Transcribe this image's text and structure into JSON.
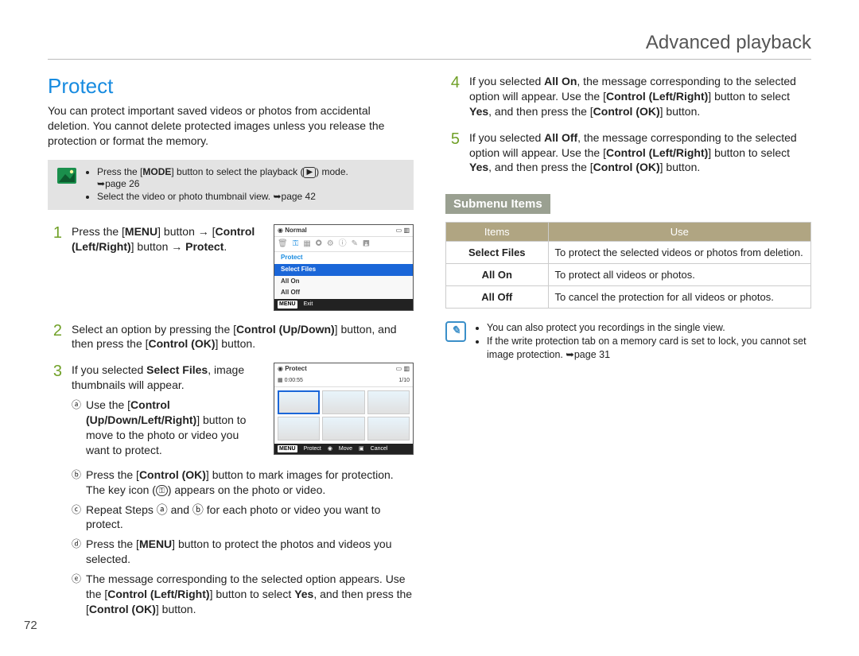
{
  "chapter": "Advanced playback",
  "page_number": "72",
  "section": {
    "title": "Protect",
    "intro": "You can protect important saved videos or photos from accidental deletion. You cannot delete protected images unless you release the protection or format the memory."
  },
  "pre_note": {
    "line1_a": "Press the [",
    "line1_b": "] button to select the playback (",
    "line1_c": ") mode.",
    "mode_label": "MODE",
    "page_ref1": "page 26",
    "line2": "Select the video or photo thumbnail view.",
    "page_ref2": "page 42"
  },
  "steps": {
    "s1": {
      "a": "Press the [",
      "menu": "MENU",
      "b": "] button",
      "c": "[",
      "ctrl_lr": "Control (Left/Right)",
      "d": "] button",
      "protect": "Protect",
      "e": "."
    },
    "s2": {
      "a": "Select an option by pressing the [",
      "ctrl_ud": "Control (Up/Down)",
      "b": "] button, and then press the [",
      "ctrl_ok": "Control (OK)",
      "c": "] button."
    },
    "s3": {
      "a": "If you selected ",
      "sel_files": "Select Files",
      "b": ", image thumbnails will appear.",
      "sub_a": {
        "a": "Use the [",
        "ctrl": "Control (Up/Down/Left/Right)",
        "b": "] button to move to the photo or video you want to protect."
      },
      "sub_b": {
        "a": "Press the [",
        "ctrl_ok": "Control (OK)",
        "b": "] button to mark images for protection. The key icon (",
        "c": ") appears on the photo or video."
      },
      "sub_c": "Repeat Steps ⓐ and ⓑ for each photo or video you want to protect.",
      "sub_d": {
        "a": "Press the [",
        "menu": "MENU",
        "b": "] button to protect the photos and videos you selected."
      },
      "sub_e": {
        "a": "The message corresponding to the selected option appears. Use the [",
        "ctrl_lr": "Control (Left/Right)",
        "b": "] button to select ",
        "yes": "Yes",
        "c": ", and then press the [",
        "ctrl_ok": "Control (OK)",
        "d": "] button."
      }
    },
    "s4": {
      "a": "If you selected ",
      "all_on": "All On",
      "b": ", the message corresponding to the selected option will appear. Use the [",
      "ctrl_lr": "Control (Left/Right)",
      "c": "] button to select ",
      "yes": "Yes",
      "d": ", and then press the [",
      "ctrl_ok": "Control (OK)",
      "e": "] button."
    },
    "s5": {
      "a": "If you selected ",
      "all_off": "All Off",
      "b": ", the message corresponding to the selected option will appear. Use the [",
      "ctrl_lr": "Control (Left/Right)",
      "c": "] button to select ",
      "yes": "Yes",
      "d": ", and then press the [",
      "ctrl_ok": "Control (OK)",
      "e": "] button."
    }
  },
  "step_numbers": {
    "n1": "1",
    "n2": "2",
    "n3": "3",
    "n4": "4",
    "n5": "5"
  },
  "circled": {
    "a": "ⓐ",
    "b": "ⓑ",
    "c": "ⓒ",
    "d": "ⓓ",
    "e": "ⓔ"
  },
  "arrow": "→",
  "key_glyph": "⚿",
  "screen1": {
    "top_left": "Normal",
    "menu_title": "Protect",
    "opt1": "Select Files",
    "opt2": "All On",
    "opt3": "All Off",
    "bottom_tag": "MENU",
    "bottom_label": "Exit"
  },
  "screen2": {
    "top_left": "Protect",
    "time": "0:00:55",
    "count": "1/10",
    "b_tag1": "MENU",
    "b_lbl1": "Protect",
    "b_lbl2": "Move",
    "b_lbl3": "Cancel"
  },
  "submenu": {
    "heading": "Submenu Items",
    "th1": "Items",
    "th2": "Use",
    "rows": [
      {
        "name": "Select Files",
        "use": "To protect the selected videos or photos from deletion."
      },
      {
        "name": "All On",
        "use": "To protect all videos or photos."
      },
      {
        "name": "All Off",
        "use": "To cancel the protection for all videos or photos."
      }
    ]
  },
  "tip": {
    "l1": "You can also protect you recordings in the single view.",
    "l2a": "If the write protection tab on a memory card is set to lock, you cannot set image protection.",
    "l2_ref": "page 31"
  }
}
